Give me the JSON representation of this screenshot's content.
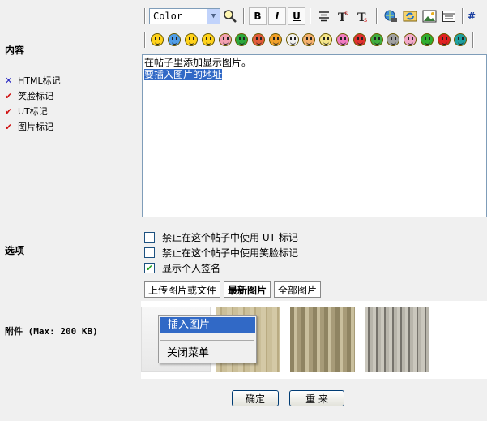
{
  "labels": {
    "content": "内容",
    "options": "选项",
    "attachments": "附件 (Max: 200 KB)"
  },
  "rules": [
    {
      "label": "HTML标记",
      "enabled": false
    },
    {
      "label": "笑脸标记",
      "enabled": true
    },
    {
      "label": "UT标记",
      "enabled": true
    },
    {
      "label": "图片标记",
      "enabled": true
    }
  ],
  "toolbar": {
    "color_value": "Color",
    "bold": "B",
    "italic": "I",
    "underline": "U",
    "icons": [
      "find-icon",
      "align-center-icon",
      "text-size-up-icon",
      "text-size-down-icon",
      "web-link-icon",
      "refresh-link-icon",
      "insert-image-icon",
      "insert-table-icon"
    ]
  },
  "smilies": [
    {
      "name": "smile",
      "color": "#ffd21a"
    },
    {
      "name": "sad",
      "color": "#4f9de8"
    },
    {
      "name": "grin",
      "color": "#ffd21a"
    },
    {
      "name": "cool",
      "color": "#ffd21a"
    },
    {
      "name": "blush",
      "color": "#f3a0b0"
    },
    {
      "name": "sick",
      "color": "#2ca83c"
    },
    {
      "name": "devil",
      "color": "#e25b3b"
    },
    {
      "name": "wink",
      "color": "#f2a12a"
    },
    {
      "name": "clown",
      "color": "#f0f0f0"
    },
    {
      "name": "laugh",
      "color": "#f4b06d"
    },
    {
      "name": "dizzy",
      "color": "#f4e58a"
    },
    {
      "name": "shock",
      "color": "#f17ac0"
    },
    {
      "name": "angry",
      "color": "#e03030"
    },
    {
      "name": "nervous",
      "color": "#3fae3f"
    },
    {
      "name": "neutral",
      "color": "#a0a0a0"
    },
    {
      "name": "kiss",
      "color": "#f2a8c8"
    },
    {
      "name": "silent",
      "color": "#2fae2f"
    },
    {
      "name": "mad",
      "color": "#e02020"
    },
    {
      "name": "question",
      "color": "#1ea0a0"
    }
  ],
  "editor": {
    "line1": "在帖子里添加显示图片。",
    "line2_selected": "要插入图片的地址"
  },
  "options": [
    {
      "label": "禁止在这个帖子中使用 UT 标记",
      "checked": false
    },
    {
      "label": "禁止在这个帖子中使用笑脸标记",
      "checked": false
    },
    {
      "label": "显示个人签名",
      "checked": true
    }
  ],
  "attach_tabs": [
    "上传图片或文件",
    "最新图片",
    "全部图片"
  ],
  "context_menu": {
    "insert": "插入图片",
    "close": "关闭菜单"
  },
  "buttons": {
    "submit": "确定",
    "reset": "重 来"
  }
}
